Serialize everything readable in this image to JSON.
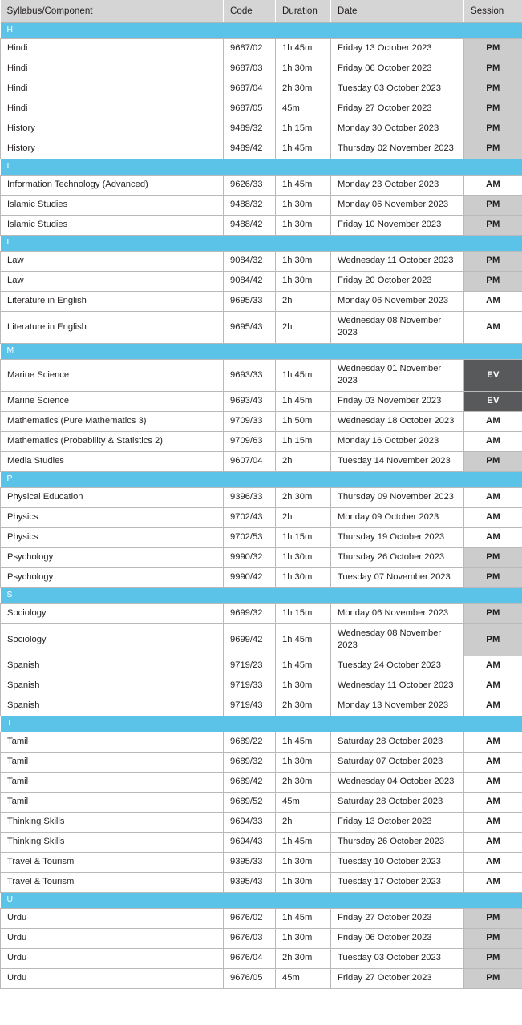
{
  "table": {
    "columns": [
      {
        "key": "syllabus",
        "label": "Syllabus/Component"
      },
      {
        "key": "code",
        "label": "Code"
      },
      {
        "key": "duration",
        "label": "Duration"
      },
      {
        "key": "date",
        "label": "Date"
      },
      {
        "key": "session",
        "label": "Session"
      }
    ],
    "colors": {
      "header_background": "#d5d5d5",
      "group_background": "#5cc3e8",
      "group_text": "#ffffff",
      "session_am_background": "#ffffff",
      "session_pm_background": "#cccccc",
      "session_ev_background": "#58595b",
      "session_ev_text": "#ffffff",
      "border": "#b9b9b9",
      "text": "#231f20"
    },
    "groups": [
      {
        "letter": "H",
        "rows": [
          {
            "syllabus": "Hindi",
            "code": "9687/02",
            "duration": "1h 45m",
            "date": "Friday 13 October 2023",
            "session": "PM"
          },
          {
            "syllabus": "Hindi",
            "code": "9687/03",
            "duration": "1h 30m",
            "date": "Friday 06 October 2023",
            "session": "PM"
          },
          {
            "syllabus": "Hindi",
            "code": "9687/04",
            "duration": "2h 30m",
            "date": "Tuesday 03 October 2023",
            "session": "PM"
          },
          {
            "syllabus": "Hindi",
            "code": "9687/05",
            "duration": "45m",
            "date": "Friday 27 October 2023",
            "session": "PM"
          },
          {
            "syllabus": "History",
            "code": "9489/32",
            "duration": "1h 15m",
            "date": "Monday 30 October 2023",
            "session": "PM"
          },
          {
            "syllabus": "History",
            "code": "9489/42",
            "duration": "1h 45m",
            "date": "Thursday 02 November 2023",
            "session": "PM"
          }
        ]
      },
      {
        "letter": "I",
        "rows": [
          {
            "syllabus": "Information Technology (Advanced)",
            "code": "9626/33",
            "duration": "1h 45m",
            "date": "Monday 23 October 2023",
            "session": "AM"
          },
          {
            "syllabus": "Islamic Studies",
            "code": "9488/32",
            "duration": "1h 30m",
            "date": "Monday 06 November 2023",
            "session": "PM"
          },
          {
            "syllabus": "Islamic Studies",
            "code": "9488/42",
            "duration": "1h 30m",
            "date": "Friday 10 November 2023",
            "session": "PM"
          }
        ]
      },
      {
        "letter": "L",
        "rows": [
          {
            "syllabus": "Law",
            "code": "9084/32",
            "duration": "1h 30m",
            "date": "Wednesday 11 October 2023",
            "session": "PM"
          },
          {
            "syllabus": "Law",
            "code": "9084/42",
            "duration": "1h 30m",
            "date": "Friday 20 October 2023",
            "session": "PM"
          },
          {
            "syllabus": "Literature in English",
            "code": "9695/33",
            "duration": "2h",
            "date": "Monday 06 November 2023",
            "session": "AM"
          },
          {
            "syllabus": "Literature in English",
            "code": "9695/43",
            "duration": "2h",
            "date": "Wednesday 08 November 2023",
            "session": "AM"
          }
        ]
      },
      {
        "letter": "M",
        "rows": [
          {
            "syllabus": "Marine Science",
            "code": "9693/33",
            "duration": "1h 45m",
            "date": "Wednesday 01 November 2023",
            "session": "EV"
          },
          {
            "syllabus": "Marine Science",
            "code": "9693/43",
            "duration": "1h 45m",
            "date": "Friday 03 November 2023",
            "session": "EV"
          },
          {
            "syllabus": "Mathematics (Pure Mathematics 3)",
            "code": "9709/33",
            "duration": "1h 50m",
            "date": "Wednesday 18 October 2023",
            "session": "AM"
          },
          {
            "syllabus": "Mathematics (Probability & Statistics 2)",
            "code": "9709/63",
            "duration": "1h 15m",
            "date": "Monday 16 October 2023",
            "session": "AM"
          },
          {
            "syllabus": "Media Studies",
            "code": "9607/04",
            "duration": "2h",
            "date": "Tuesday 14 November 2023",
            "session": "PM"
          }
        ]
      },
      {
        "letter": "P",
        "rows": [
          {
            "syllabus": "Physical Education",
            "code": "9396/33",
            "duration": "2h 30m",
            "date": "Thursday 09 November 2023",
            "session": "AM"
          },
          {
            "syllabus": "Physics",
            "code": "9702/43",
            "duration": "2h",
            "date": "Monday 09 October 2023",
            "session": "AM"
          },
          {
            "syllabus": "Physics",
            "code": "9702/53",
            "duration": "1h 15m",
            "date": "Thursday 19 October 2023",
            "session": "AM"
          },
          {
            "syllabus": "Psychology",
            "code": "9990/32",
            "duration": "1h 30m",
            "date": "Thursday 26 October 2023",
            "session": "PM"
          },
          {
            "syllabus": "Psychology",
            "code": "9990/42",
            "duration": "1h 30m",
            "date": "Tuesday 07 November 2023",
            "session": "PM"
          }
        ]
      },
      {
        "letter": "S",
        "rows": [
          {
            "syllabus": "Sociology",
            "code": "9699/32",
            "duration": "1h 15m",
            "date": "Monday 06 November 2023",
            "session": "PM"
          },
          {
            "syllabus": "Sociology",
            "code": "9699/42",
            "duration": "1h 45m",
            "date": "Wednesday 08 November 2023",
            "session": "PM"
          },
          {
            "syllabus": "Spanish",
            "code": "9719/23",
            "duration": "1h 45m",
            "date": "Tuesday 24 October 2023",
            "session": "AM"
          },
          {
            "syllabus": "Spanish",
            "code": "9719/33",
            "duration": "1h 30m",
            "date": "Wednesday 11 October 2023",
            "session": "AM"
          },
          {
            "syllabus": "Spanish",
            "code": "9719/43",
            "duration": "2h 30m",
            "date": "Monday 13 November 2023",
            "session": "AM"
          }
        ]
      },
      {
        "letter": "T",
        "rows": [
          {
            "syllabus": "Tamil",
            "code": "9689/22",
            "duration": "1h 45m",
            "date": "Saturday 28 October 2023",
            "session": "AM"
          },
          {
            "syllabus": "Tamil",
            "code": "9689/32",
            "duration": "1h 30m",
            "date": "Saturday 07 October 2023",
            "session": "AM"
          },
          {
            "syllabus": "Tamil",
            "code": "9689/42",
            "duration": "2h 30m",
            "date": "Wednesday 04 October 2023",
            "session": "AM"
          },
          {
            "syllabus": "Tamil",
            "code": "9689/52",
            "duration": "45m",
            "date": "Saturday 28 October 2023",
            "session": "AM"
          },
          {
            "syllabus": "Thinking Skills",
            "code": "9694/33",
            "duration": "2h",
            "date": "Friday 13 October 2023",
            "session": "AM"
          },
          {
            "syllabus": "Thinking Skills",
            "code": "9694/43",
            "duration": "1h 45m",
            "date": "Thursday 26 October 2023",
            "session": "AM"
          },
          {
            "syllabus": "Travel & Tourism",
            "code": "9395/33",
            "duration": "1h 30m",
            "date": "Tuesday 10 October 2023",
            "session": "AM"
          },
          {
            "syllabus": "Travel & Tourism",
            "code": "9395/43",
            "duration": "1h 30m",
            "date": "Tuesday 17 October 2023",
            "session": "AM"
          }
        ]
      },
      {
        "letter": "U",
        "rows": [
          {
            "syllabus": "Urdu",
            "code": "9676/02",
            "duration": "1h 45m",
            "date": "Friday 27 October 2023",
            "session": "PM"
          },
          {
            "syllabus": "Urdu",
            "code": "9676/03",
            "duration": "1h 30m",
            "date": "Friday 06 October 2023",
            "session": "PM"
          },
          {
            "syllabus": "Urdu",
            "code": "9676/04",
            "duration": "2h 30m",
            "date": "Tuesday 03 October 2023",
            "session": "PM"
          },
          {
            "syllabus": "Urdu",
            "code": "9676/05",
            "duration": "45m",
            "date": "Friday 27 October 2023",
            "session": "PM"
          }
        ]
      }
    ]
  }
}
